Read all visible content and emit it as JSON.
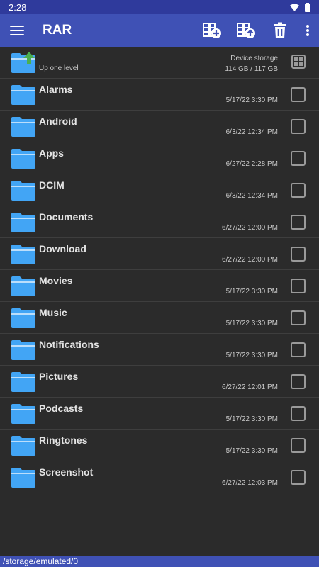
{
  "status": {
    "time": "2:28"
  },
  "app": {
    "title": "RAR"
  },
  "parent": {
    "label": "Up one level",
    "storage_label": "Device storage",
    "storage_size": "114 GB / 117 GB"
  },
  "folders": [
    {
      "name": "Alarms",
      "date": "5/17/22 3:30 PM"
    },
    {
      "name": "Android",
      "date": "6/3/22 12:34 PM"
    },
    {
      "name": "Apps",
      "date": "6/27/22 2:28 PM"
    },
    {
      "name": "DCIM",
      "date": "6/3/22 12:34 PM"
    },
    {
      "name": "Documents",
      "date": "6/27/22 12:00 PM"
    },
    {
      "name": "Download",
      "date": "6/27/22 12:00 PM"
    },
    {
      "name": "Movies",
      "date": "5/17/22 3:30 PM"
    },
    {
      "name": "Music",
      "date": "5/17/22 3:30 PM"
    },
    {
      "name": "Notifications",
      "date": "5/17/22 3:30 PM"
    },
    {
      "name": "Pictures",
      "date": "6/27/22 12:01 PM"
    },
    {
      "name": "Podcasts",
      "date": "5/17/22 3:30 PM"
    },
    {
      "name": "Ringtones",
      "date": "5/17/22 3:30 PM"
    },
    {
      "name": "Screenshot",
      "date": "6/27/22 12:03 PM"
    }
  ],
  "path": "/storage/emulated/0",
  "colors": {
    "app_bar": "#3f51b5",
    "status_bar": "#2f3a9c",
    "folder": "#42a5f5",
    "background": "#2b2b2b",
    "up_arrow": "#4caf50"
  }
}
